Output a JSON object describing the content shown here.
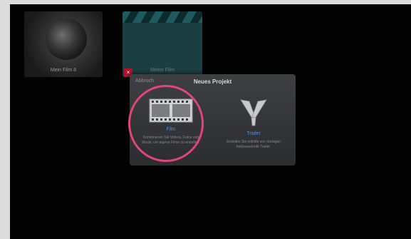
{
  "projects": [
    {
      "label": "Mein Film 8"
    },
    {
      "label": "Meins Film"
    }
  ],
  "badge_text": "×",
  "dialog": {
    "cancel_label": "Abbruch",
    "title": "Neues Projekt",
    "options": [
      {
        "label": "Film",
        "description": "Kombinieren Sie Videos, Fotos und Musik, um eigene Filme zu erstellen.",
        "icon": "film-strip-icon"
      },
      {
        "label": "Trailer",
        "description": "Erstellen Sie mithilfe von Vorlagen hollywoodreife Trailer.",
        "icon": "trailer-searchlights-icon"
      }
    ]
  },
  "colors": {
    "accent_label": "#4f8fd6",
    "highlight_ring": "#e0457a",
    "badge": "#b3122b"
  }
}
